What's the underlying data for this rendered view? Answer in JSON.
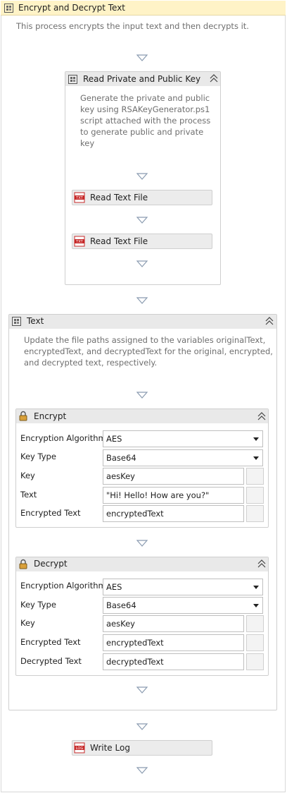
{
  "main": {
    "title": "Encrypt and Decrypt Text",
    "description": "This process encrypts the input text and then decrypts it."
  },
  "keyScope": {
    "title": "Read Private and Public Key",
    "description_lines": [
      "Generate the private and public",
      "key using RSAKeyGenerator.ps1",
      "script attached with the process",
      "to generate public and private",
      "key"
    ],
    "activities": [
      "Read Text File",
      "Read Text File"
    ]
  },
  "textScope": {
    "title": "Text",
    "description_lines": [
      "Update the file paths assigned to the variables originalText,",
      "encryptedText, and decryptedText for the original, encrypted,",
      "and decrypted text, respectively."
    ]
  },
  "encrypt": {
    "title": "Encrypt",
    "labels": {
      "algorithm": "Encryption Algorithm",
      "keyType": "Key Type",
      "key": "Key",
      "text": "Text",
      "result": "Encrypted Text"
    },
    "values": {
      "algorithm": "AES",
      "keyType": "Base64",
      "key": "aesKey",
      "text": "\"Hi! Hello! How are you?\"",
      "result": "encryptedText"
    }
  },
  "decrypt": {
    "title": "Decrypt",
    "labels": {
      "algorithm": "Encryption Algorithm",
      "keyType": "Key Type",
      "key": "Key",
      "text": "Encrypted Text",
      "result": "Decrypted Text"
    },
    "values": {
      "algorithm": "AES",
      "keyType": "Base64",
      "key": "aesKey",
      "text": "encryptedText",
      "result": "decryptedText"
    }
  },
  "writeLog": {
    "title": "Write Log"
  },
  "icons": {
    "sequence": "sequence-icon",
    "file": "text-file-icon",
    "lock": "lock-icon",
    "log": "log-icon",
    "collapse": "collapse-icon",
    "arrow": "flow-arrow-icon"
  },
  "colors": {
    "header": "#fff3c7",
    "scopeHeader": "#e9e9e9",
    "activity": "#ececec",
    "fileIcon": "#c62828"
  }
}
